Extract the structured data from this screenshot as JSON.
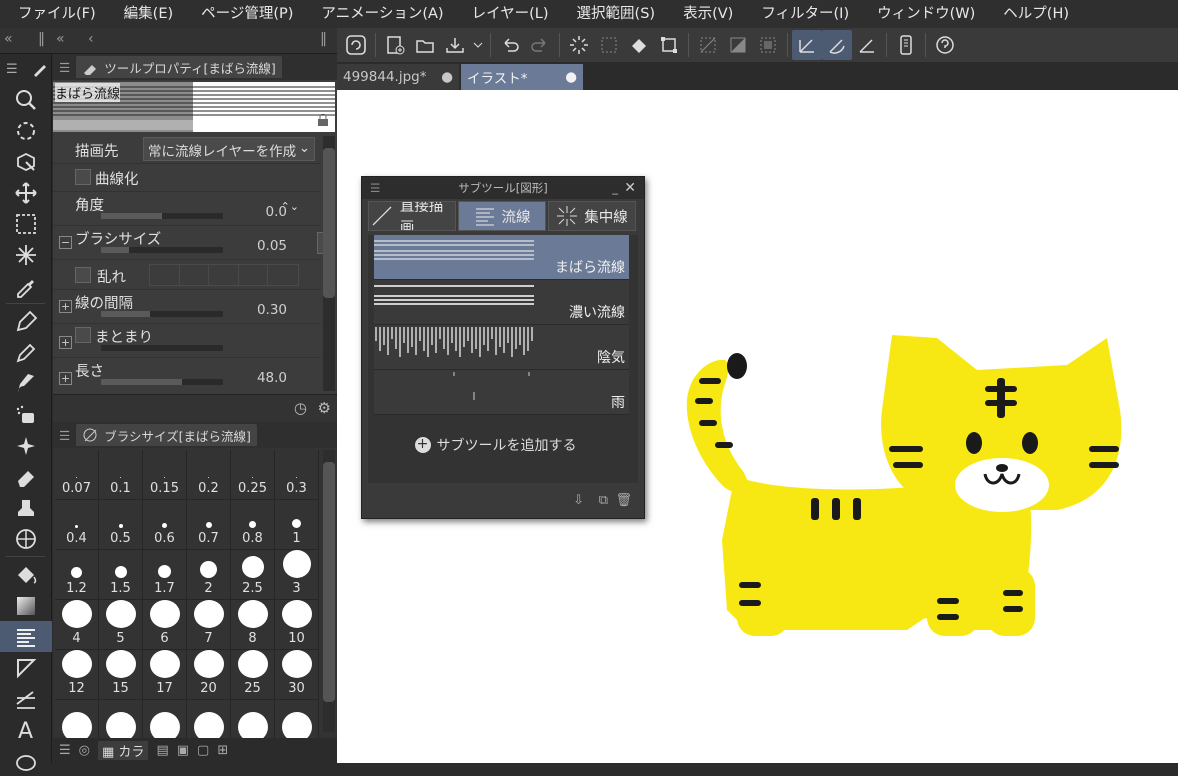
{
  "menu": {
    "items": [
      "ファイル(F)",
      "編集(E)",
      "ページ管理(P)",
      "アニメーション(A)",
      "レイヤー(L)",
      "選択範囲(S)",
      "表示(V)",
      "フィルター(I)",
      "ウィンドウ(W)",
      "ヘルプ(H)"
    ]
  },
  "tabs": [
    {
      "label": "499844.jpg*"
    },
    {
      "label": "イラスト*"
    }
  ],
  "tool_property": {
    "title": "ツールプロパティ[まばら流線]",
    "preview_name": "まばら流線",
    "target_label": "描画先",
    "target_value": "常に流線レイヤーを作成",
    "curve_label": "曲線化",
    "angle_label": "角度",
    "angle_value": "0.0",
    "brushsize_label": "ブラシサイズ",
    "brushsize_value": "0.05",
    "disorder_label": "乱れ",
    "spacing_label": "線の間隔",
    "spacing_value": "0.30",
    "group_label": "まとまり",
    "length_label": "長さ",
    "length_value": "48.0"
  },
  "brush_size": {
    "title": "ブラシサイズ[まばら流線]",
    "sizes": [
      "0.07",
      "0.1",
      "0.15",
      "0.2",
      "0.25",
      "0.3",
      "0.4",
      "0.5",
      "0.6",
      "0.7",
      "0.8",
      "1",
      "1.2",
      "1.5",
      "1.7",
      "2",
      "2.5",
      "3",
      "4",
      "5",
      "6",
      "7",
      "8",
      "10",
      "12",
      "15",
      "17",
      "20",
      "25",
      "30",
      "",
      "",
      "",
      "",
      "",
      ""
    ],
    "bottom_tab": "カラ"
  },
  "subtool": {
    "title": "サブツール[図形]",
    "tabs": [
      "直接描画",
      "流線",
      "集中線"
    ],
    "items": [
      "まばら流線",
      "濃い流線",
      "陰気",
      "雨"
    ],
    "add_label": "サブツールを追加する"
  },
  "colors": {
    "accent": "#6b7a96",
    "tiger_yellow": "#f7e814",
    "stripe": "#1a1a1a"
  }
}
